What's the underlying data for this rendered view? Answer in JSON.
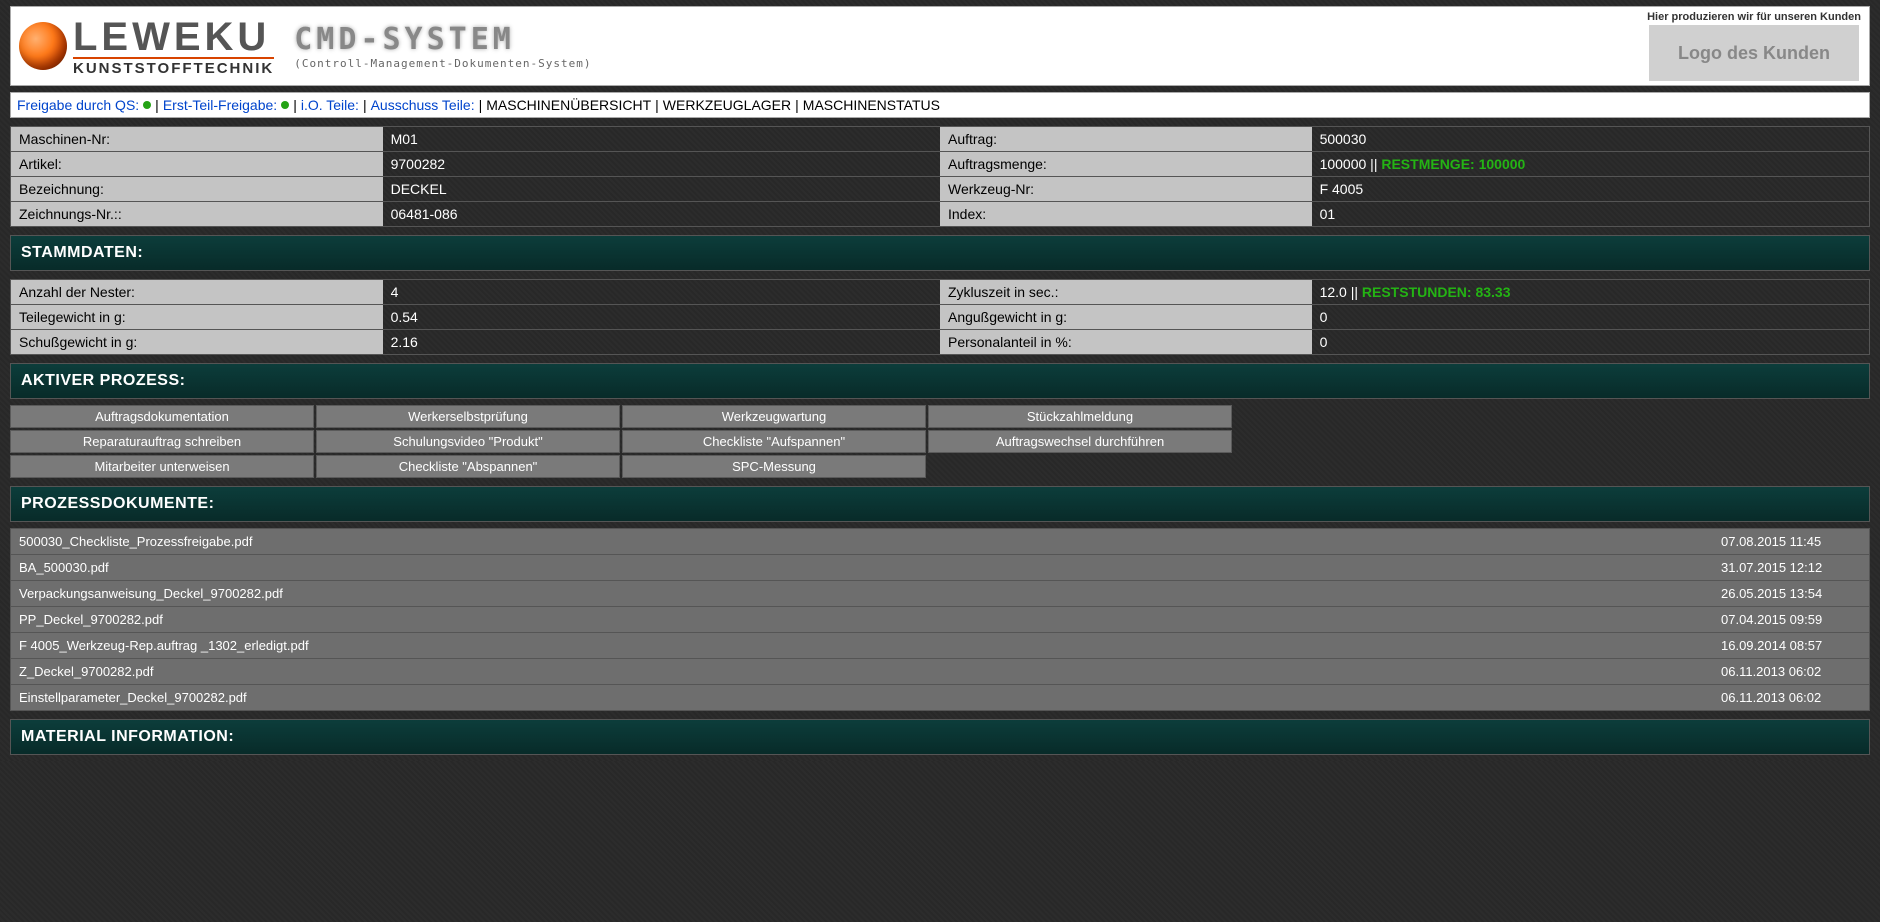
{
  "header": {
    "leweku_big": "LEWEKU",
    "leweku_small": "KUNSTSTOFFTECHNIK",
    "cmd_big": "CMD-SYSTEM",
    "cmd_sub": "(Controll-Management-Dokumenten-System)",
    "kunde_hint": "Hier produzieren wir für unseren Kunden",
    "kunde_logo": "Logo des Kunden"
  },
  "nav": {
    "qs": "Freigabe durch QS:",
    "erst": "Erst-Teil-Freigabe:",
    "io": "i.O. Teile:",
    "auss": "Ausschuss Teile:",
    "m1": "MASCHINENÜBERSICHT",
    "m2": "WERKZEUGLAGER",
    "m3": "MASCHINENSTATUS"
  },
  "info": {
    "l1a": "Maschinen-Nr:",
    "v1a": "M01",
    "l1b": "Auftrag:",
    "v1b": "500030",
    "l2a": "Artikel:",
    "v2a": "9700282",
    "l2b": "Auftragsmenge:",
    "v2b": "100000 || ",
    "v2b_extra": "RESTMENGE: 100000",
    "l3a": "Bezeichnung:",
    "v3a": "DECKEL",
    "l3b": "Werkzeug-Nr:",
    "v3b": "F 4005",
    "l4a": "Zeichnungs-Nr.::",
    "v4a": "06481-086",
    "l4b": "Index:",
    "v4b": "01"
  },
  "sec1": "STAMMDATEN:",
  "stamm": {
    "l1a": "Anzahl der Nester:",
    "v1a": "4",
    "l1b": "Zykluszeit in sec.:",
    "v1b": "12.0 || ",
    "v1b_extra": "RESTSTUNDEN: 83.33",
    "l2a": "Teilegewicht in g:",
    "v2a": "0.54",
    "l2b": "Angußgewicht in g:",
    "v2b": "0",
    "l3a": "Schußgewicht in g:",
    "v3a": "2.16",
    "l3b": "Personalanteil in %:",
    "v3b": "0"
  },
  "sec2": "AKTIVER PROZESS:",
  "proc": [
    "Auftragsdokumentation",
    "Werkerselbstprüfung",
    "Werkzeugwartung",
    "Stückzahlmeldung",
    "Reparaturauftrag schreiben",
    "Schulungsvideo \"Produkt\"",
    "Checkliste \"Aufspannen\"",
    "Auftragswechsel durchführen",
    "Mitarbeiter unterweisen",
    "Checkliste \"Abspannen\"",
    "SPC-Messung"
  ],
  "sec3": "PROZESSDOKUMENTE:",
  "docs": [
    {
      "name": "500030_Checkliste_Prozessfreigabe.pdf",
      "date": "07.08.2015 11:45"
    },
    {
      "name": "BA_500030.pdf",
      "date": "31.07.2015 12:12"
    },
    {
      "name": "Verpackungsanweisung_Deckel_9700282.pdf",
      "date": "26.05.2015 13:54"
    },
    {
      "name": "PP_Deckel_9700282.pdf",
      "date": "07.04.2015 09:59"
    },
    {
      "name": "F 4005_Werkzeug-Rep.auftrag _1302_erledigt.pdf",
      "date": "16.09.2014 08:57"
    },
    {
      "name": "Z_Deckel_9700282.pdf",
      "date": "06.11.2013 06:02"
    },
    {
      "name": "Einstellparameter_Deckel_9700282.pdf",
      "date": "06.11.2013 06:02"
    }
  ],
  "sec4": "MATERIAL INFORMATION:"
}
